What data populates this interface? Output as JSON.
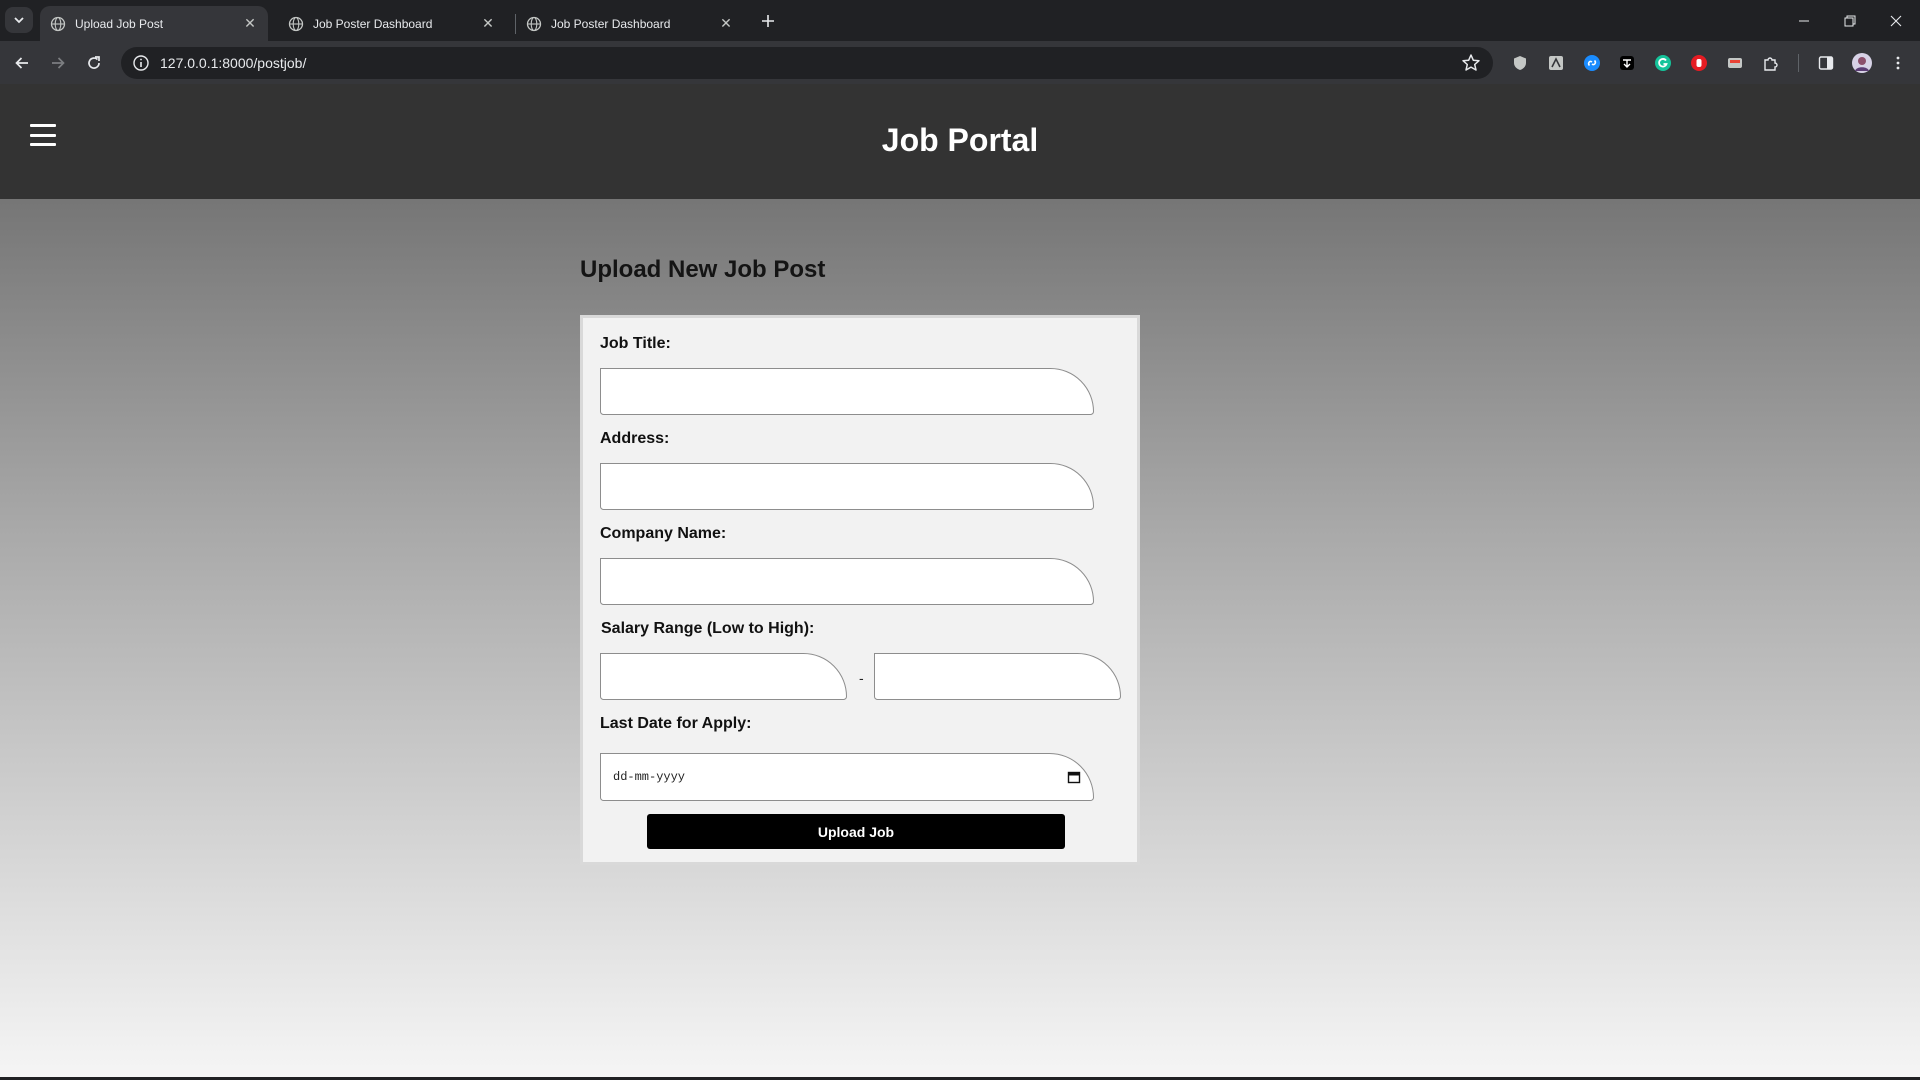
{
  "browser": {
    "tabs": [
      {
        "title": "Upload Job Post",
        "active": true
      },
      {
        "title": "Job Poster Dashboard",
        "active": false
      },
      {
        "title": "Job Poster Dashboard",
        "active": false
      }
    ],
    "url": "127.0.0.1:8000/postjob/",
    "extension_icons": [
      "shield-icon",
      "bookmark-manager-icon",
      "shazam-icon",
      "ext-icon",
      "grammarly-icon",
      "adblock-icon",
      "media-icon",
      "extensions-puzzle-icon"
    ]
  },
  "site": {
    "title": "Job Portal"
  },
  "form": {
    "heading": "Upload New Job Post",
    "job_title_label": "Job Title:",
    "job_title_value": "",
    "address_label": "Address:",
    "address_value": "",
    "company_label": "Company Name:",
    "company_value": "",
    "salary_label": "Salary Range (Low to High):",
    "salary_low_value": "",
    "salary_high_value": "",
    "salary_separator": "-",
    "date_label": "Last Date for Apply:",
    "date_placeholder": "dd-mm-yyyy",
    "submit_label": "Upload Job"
  },
  "colors": {
    "header_bg": "#333333",
    "button_bg": "#000000",
    "card_bg": "#f2f2f2"
  }
}
